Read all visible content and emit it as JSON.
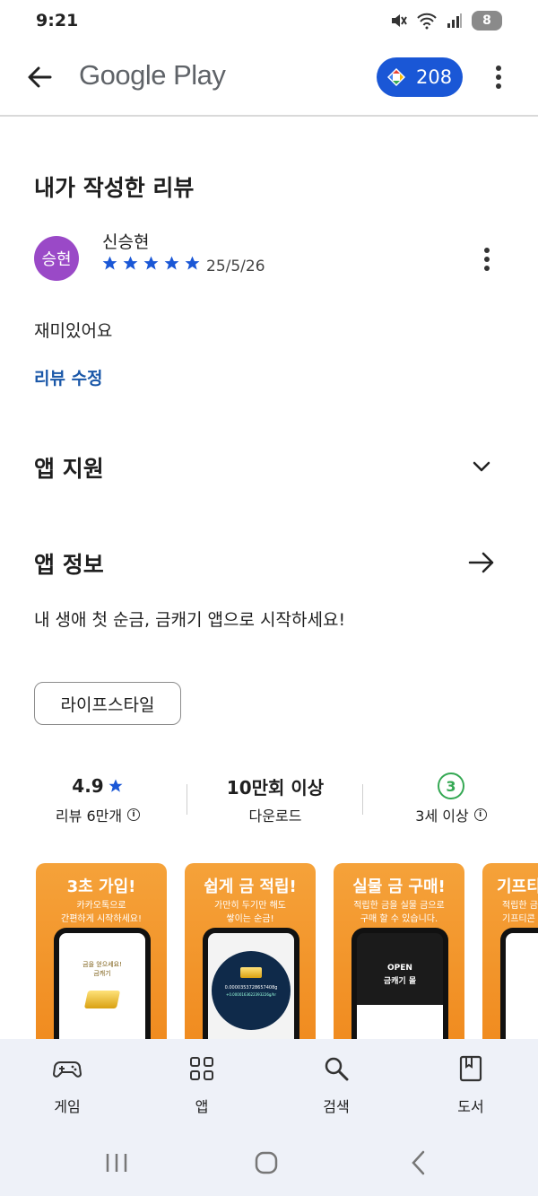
{
  "status_bar": {
    "time": "9:21",
    "battery": "8"
  },
  "app_bar": {
    "brand": "Google Play",
    "points": "208"
  },
  "my_review": {
    "section_title": "내가 작성한 리뷰",
    "avatar_text": "승현",
    "reviewer_name": "신승현",
    "rating": 5,
    "date": "25/5/26",
    "text": "재미있어요",
    "edit_label": "리뷰 수정"
  },
  "app_support": {
    "title": "앱 지원"
  },
  "app_info": {
    "title": "앱 정보",
    "description": "내 생애 첫 순금, 금캐기 앱으로 시작하세요!",
    "category": "라이프스타일"
  },
  "stats": {
    "rating_value": "4.9",
    "rating_label": "리뷰 6만개",
    "downloads_value": "10만회 이상",
    "downloads_label": "다운로드",
    "age_value": "3",
    "age_label": "3세 이상"
  },
  "screenshots": [
    {
      "title": "3초 가입!",
      "subtitle_line1": "카카오톡으로",
      "subtitle_line2": "간편하게 시작하세요!",
      "screen_line1": "금을 얻으세요!",
      "screen_line2": "금캐기"
    },
    {
      "title": "쉽게 금 적립!",
      "subtitle_line1": "가만히 두기만 해도",
      "subtitle_line2": "쌓이는 순금!",
      "screen_line1": "0.0000353728657408g",
      "screen_line2": "+0.0000163622393226g/hr"
    },
    {
      "title": "실물 금 구매!",
      "subtitle_line1": "적립한 금을 실물 금으로",
      "subtitle_line2": "구매 할 수 있습니다.",
      "screen_line1": "OPEN",
      "screen_line2": "금캐기 몰"
    },
    {
      "title": "기프티",
      "subtitle_line1": "적립한 금",
      "subtitle_line2": "기프티콘",
      "screen_line1": "",
      "screen_line2": ""
    }
  ],
  "bottom_nav": [
    {
      "label": "게임",
      "icon": "gamepad-icon"
    },
    {
      "label": "앱",
      "icon": "apps-grid-icon"
    },
    {
      "label": "검색",
      "icon": "search-icon"
    },
    {
      "label": "도서",
      "icon": "book-icon"
    }
  ],
  "colors": {
    "accent": "#1a57d6",
    "link": "#1a57a8",
    "star": "#1a57d6",
    "avatar": "#9a49c7",
    "age_badge": "#34a853",
    "shot_bg": "#f08a1e"
  }
}
